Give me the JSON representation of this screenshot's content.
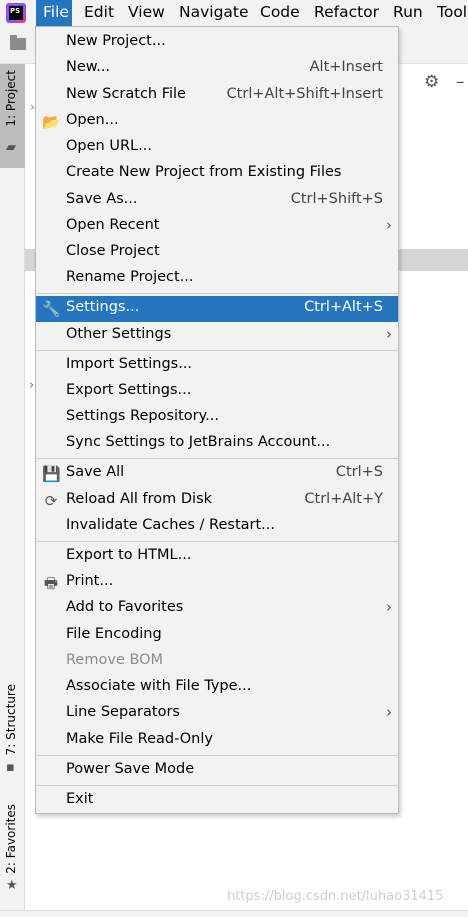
{
  "menubar": {
    "logo_text": "PS",
    "items": [
      {
        "label": "File"
      },
      {
        "label": "Edit"
      },
      {
        "label": "View"
      },
      {
        "label": "Navigate"
      },
      {
        "label": "Code"
      },
      {
        "label": "Refactor"
      },
      {
        "label": "Run"
      },
      {
        "label": "Tool"
      }
    ]
  },
  "left_strip": {
    "project_tab": "1: Project",
    "structure_tab": "7: Structure",
    "favorites_tab": "2: Favorites"
  },
  "file_menu": {
    "items": [
      {
        "label": "New Project...",
        "shortcut": ""
      },
      {
        "label": "New...",
        "shortcut": "Alt+Insert"
      },
      {
        "label": "New Scratch File",
        "shortcut": "Ctrl+Alt+Shift+Insert"
      },
      {
        "label": "Open...",
        "shortcut": "",
        "icon": "folder-open-icon"
      },
      {
        "label": "Open URL...",
        "shortcut": ""
      },
      {
        "label": "Create New Project from Existing Files",
        "shortcut": ""
      },
      {
        "label": "Save As...",
        "shortcut": "Ctrl+Shift+S"
      },
      {
        "label": "Open Recent",
        "shortcut": "",
        "submenu": true
      },
      {
        "label": "Close Project",
        "shortcut": ""
      },
      {
        "label": "Rename Project...",
        "shortcut": ""
      },
      {
        "label": "Settings...",
        "shortcut": "Ctrl+Alt+S",
        "icon": "wrench-icon",
        "selected": true
      },
      {
        "label": "Other Settings",
        "shortcut": "",
        "submenu": true
      },
      {
        "label": "Import Settings...",
        "shortcut": ""
      },
      {
        "label": "Export Settings...",
        "shortcut": ""
      },
      {
        "label": "Settings Repository...",
        "shortcut": ""
      },
      {
        "label": "Sync Settings to JetBrains Account...",
        "shortcut": ""
      },
      {
        "label": "Save All",
        "shortcut": "Ctrl+S",
        "icon": "save-icon"
      },
      {
        "label": "Reload All from Disk",
        "shortcut": "Ctrl+Alt+Y",
        "icon": "reload-icon"
      },
      {
        "label": "Invalidate Caches / Restart...",
        "shortcut": ""
      },
      {
        "label": "Export to HTML...",
        "shortcut": ""
      },
      {
        "label": "Print...",
        "shortcut": "",
        "icon": "printer-icon"
      },
      {
        "label": "Add to Favorites",
        "shortcut": "",
        "submenu": true
      },
      {
        "label": "File Encoding",
        "shortcut": ""
      },
      {
        "label": "Remove BOM",
        "shortcut": "",
        "disabled": true
      },
      {
        "label": "Associate with File Type...",
        "shortcut": ""
      },
      {
        "label": "Line Separators",
        "shortcut": "",
        "submenu": true
      },
      {
        "label": "Make File Read-Only",
        "shortcut": ""
      },
      {
        "label": "Power Save Mode",
        "shortcut": ""
      },
      {
        "label": "Exit",
        "shortcut": ""
      }
    ]
  },
  "watermark": "https://blog.csdn.net/luhao31415",
  "colors": {
    "selection": "#2675bf",
    "menu_bg": "#f2f2f2",
    "separator": "#cfcfcf"
  }
}
